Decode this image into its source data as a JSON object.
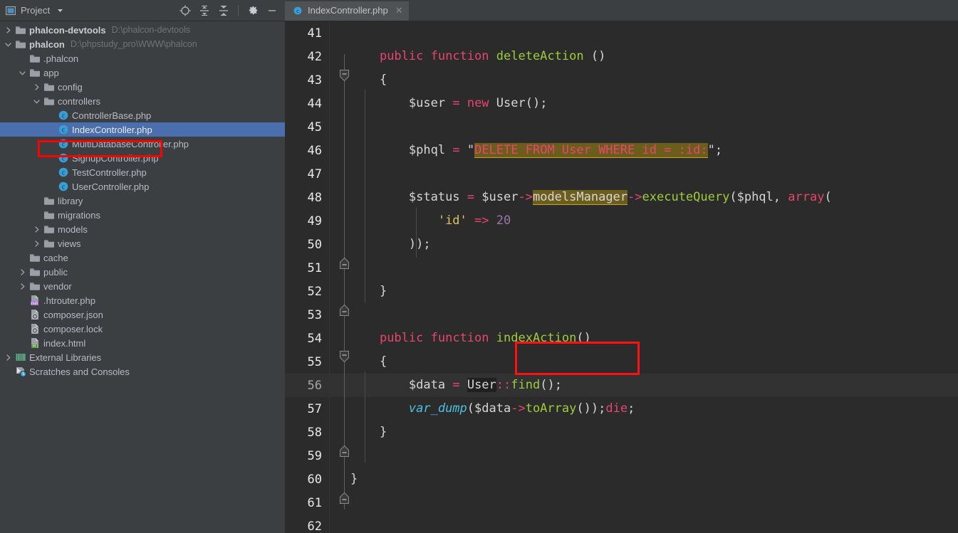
{
  "colors": {
    "accent_selection": "#4b6eaf",
    "annotation_red": "#ff0000",
    "editor_bg": "#2b2b2b",
    "panel_bg": "#3c3f41",
    "current_line_bg": "#323232",
    "highlight_olive": "#6b5e1d"
  },
  "project_panel": {
    "title": "Project",
    "dropdown_icon": "chevron-down-icon",
    "window_icon": "project-window-icon",
    "toolbar": [
      {
        "name": "select-opened-file-icon",
        "glyph": "target-crosshair"
      },
      {
        "name": "expand-all-icon",
        "glyph": "expand-all"
      },
      {
        "name": "collapse-all-icon",
        "glyph": "collapse-all"
      },
      {
        "name": "settings-gear-icon",
        "glyph": "gear"
      },
      {
        "name": "hide-panel-icon",
        "glyph": "minus"
      }
    ]
  },
  "tree": {
    "selected_index": 7,
    "items": [
      {
        "depth": 0,
        "arrow": "right",
        "icon": "folder-icon",
        "label": "phalcon-devtools",
        "bold": true,
        "sub": "D:\\phalcon-devtools"
      },
      {
        "depth": 0,
        "arrow": "down",
        "icon": "folder-icon",
        "label": "phalcon",
        "bold": true,
        "sub": "D:\\phpstudy_pro\\WWW\\phalcon"
      },
      {
        "depth": 1,
        "arrow": "none",
        "icon": "folder-icon",
        "label": ".phalcon",
        "bold": false,
        "sub": ""
      },
      {
        "depth": 1,
        "arrow": "down",
        "icon": "folder-icon",
        "label": "app",
        "bold": false,
        "sub": ""
      },
      {
        "depth": 2,
        "arrow": "right",
        "icon": "folder-icon",
        "label": "config",
        "bold": false,
        "sub": ""
      },
      {
        "depth": 2,
        "arrow": "down",
        "icon": "folder-icon",
        "label": "controllers",
        "bold": false,
        "sub": ""
      },
      {
        "depth": 3,
        "arrow": "none",
        "icon": "php-class-icon",
        "label": "ControllerBase.php",
        "bold": false,
        "sub": ""
      },
      {
        "depth": 3,
        "arrow": "none",
        "icon": "php-class-icon",
        "label": "IndexController.php",
        "bold": false,
        "sub": ""
      },
      {
        "depth": 3,
        "arrow": "none",
        "icon": "php-class-icon",
        "label": "MultiDatabaseController.php",
        "bold": false,
        "sub": ""
      },
      {
        "depth": 3,
        "arrow": "none",
        "icon": "php-class-icon",
        "label": "SignupController.php",
        "bold": false,
        "sub": ""
      },
      {
        "depth": 3,
        "arrow": "none",
        "icon": "php-class-icon",
        "label": "TestController.php",
        "bold": false,
        "sub": ""
      },
      {
        "depth": 3,
        "arrow": "none",
        "icon": "php-class-icon",
        "label": "UserController.php",
        "bold": false,
        "sub": ""
      },
      {
        "depth": 2,
        "arrow": "none",
        "icon": "folder-icon",
        "label": "library",
        "bold": false,
        "sub": ""
      },
      {
        "depth": 2,
        "arrow": "none",
        "icon": "folder-icon",
        "label": "migrations",
        "bold": false,
        "sub": ""
      },
      {
        "depth": 2,
        "arrow": "right",
        "icon": "folder-icon",
        "label": "models",
        "bold": false,
        "sub": ""
      },
      {
        "depth": 2,
        "arrow": "right",
        "icon": "folder-icon",
        "label": "views",
        "bold": false,
        "sub": ""
      },
      {
        "depth": 1,
        "arrow": "none",
        "icon": "folder-icon",
        "label": "cache",
        "bold": false,
        "sub": ""
      },
      {
        "depth": 1,
        "arrow": "right",
        "icon": "folder-icon",
        "label": "public",
        "bold": false,
        "sub": ""
      },
      {
        "depth": 1,
        "arrow": "right",
        "icon": "folder-icon",
        "label": "vendor",
        "bold": false,
        "sub": ""
      },
      {
        "depth": 1,
        "arrow": "none",
        "icon": "php-file-icon",
        "label": ".htrouter.php",
        "bold": false,
        "sub": ""
      },
      {
        "depth": 1,
        "arrow": "none",
        "icon": "json-file-icon",
        "label": "composer.json",
        "bold": false,
        "sub": ""
      },
      {
        "depth": 1,
        "arrow": "none",
        "icon": "json-file-icon",
        "label": "composer.lock",
        "bold": false,
        "sub": ""
      },
      {
        "depth": 1,
        "arrow": "none",
        "icon": "html-file-icon",
        "label": "index.html",
        "bold": false,
        "sub": ""
      },
      {
        "depth": 0,
        "arrow": "right",
        "icon": "external-libraries-icon",
        "label": "External Libraries",
        "bold": false,
        "sub": ""
      },
      {
        "depth": 0,
        "arrow": "none",
        "icon": "scratches-icon",
        "label": "Scratches and Consoles",
        "bold": false,
        "sub": ""
      }
    ]
  },
  "editor": {
    "tab": {
      "label": "IndexController.php",
      "icon": "php-class-icon",
      "close_icon": "close-icon"
    },
    "current_line": 56,
    "first_line": 41,
    "last_line": 62,
    "lines": [
      {
        "n": 41,
        "text": ""
      },
      {
        "n": 42,
        "text": "    public function deleteAction ()"
      },
      {
        "n": 43,
        "text": "    {"
      },
      {
        "n": 44,
        "text": "        $user = new User();"
      },
      {
        "n": 45,
        "text": ""
      },
      {
        "n": 46,
        "text": "        $phql = \"DELETE FROM User WHERE id = :id:\";"
      },
      {
        "n": 47,
        "text": ""
      },
      {
        "n": 48,
        "text": "        $status = $user->modelsManager->executeQuery($phql, array("
      },
      {
        "n": 49,
        "text": "            'id' => 20"
      },
      {
        "n": 50,
        "text": "        ));"
      },
      {
        "n": 51,
        "text": ""
      },
      {
        "n": 52,
        "text": "    }"
      },
      {
        "n": 53,
        "text": ""
      },
      {
        "n": 54,
        "text": "    public function indexAction()"
      },
      {
        "n": 55,
        "text": "    {"
      },
      {
        "n": 56,
        "text": "        $data = User::find();"
      },
      {
        "n": 57,
        "text": "        var_dump($data->toArray());die;"
      },
      {
        "n": 58,
        "text": "    }"
      },
      {
        "n": 59,
        "text": ""
      },
      {
        "n": 60,
        "text": "}"
      },
      {
        "n": 61,
        "text": ""
      },
      {
        "n": 62,
        "text": ""
      }
    ],
    "highlights": [
      {
        "line": 46,
        "token": "DELETE FROM User WHERE id = :id:",
        "style": "olive-highlight"
      },
      {
        "line": 48,
        "token": "modelsManager",
        "style": "olive-highlight"
      },
      {
        "line": 56,
        "token": "User",
        "style": "identifier-box"
      }
    ],
    "annotations": [
      {
        "target": "indexAction()",
        "line": 54,
        "color": "#ff1111",
        "shape": "rectangle"
      },
      {
        "target": "IndexController.php tree row",
        "color": "#ff0000",
        "shape": "rectangle"
      }
    ]
  }
}
